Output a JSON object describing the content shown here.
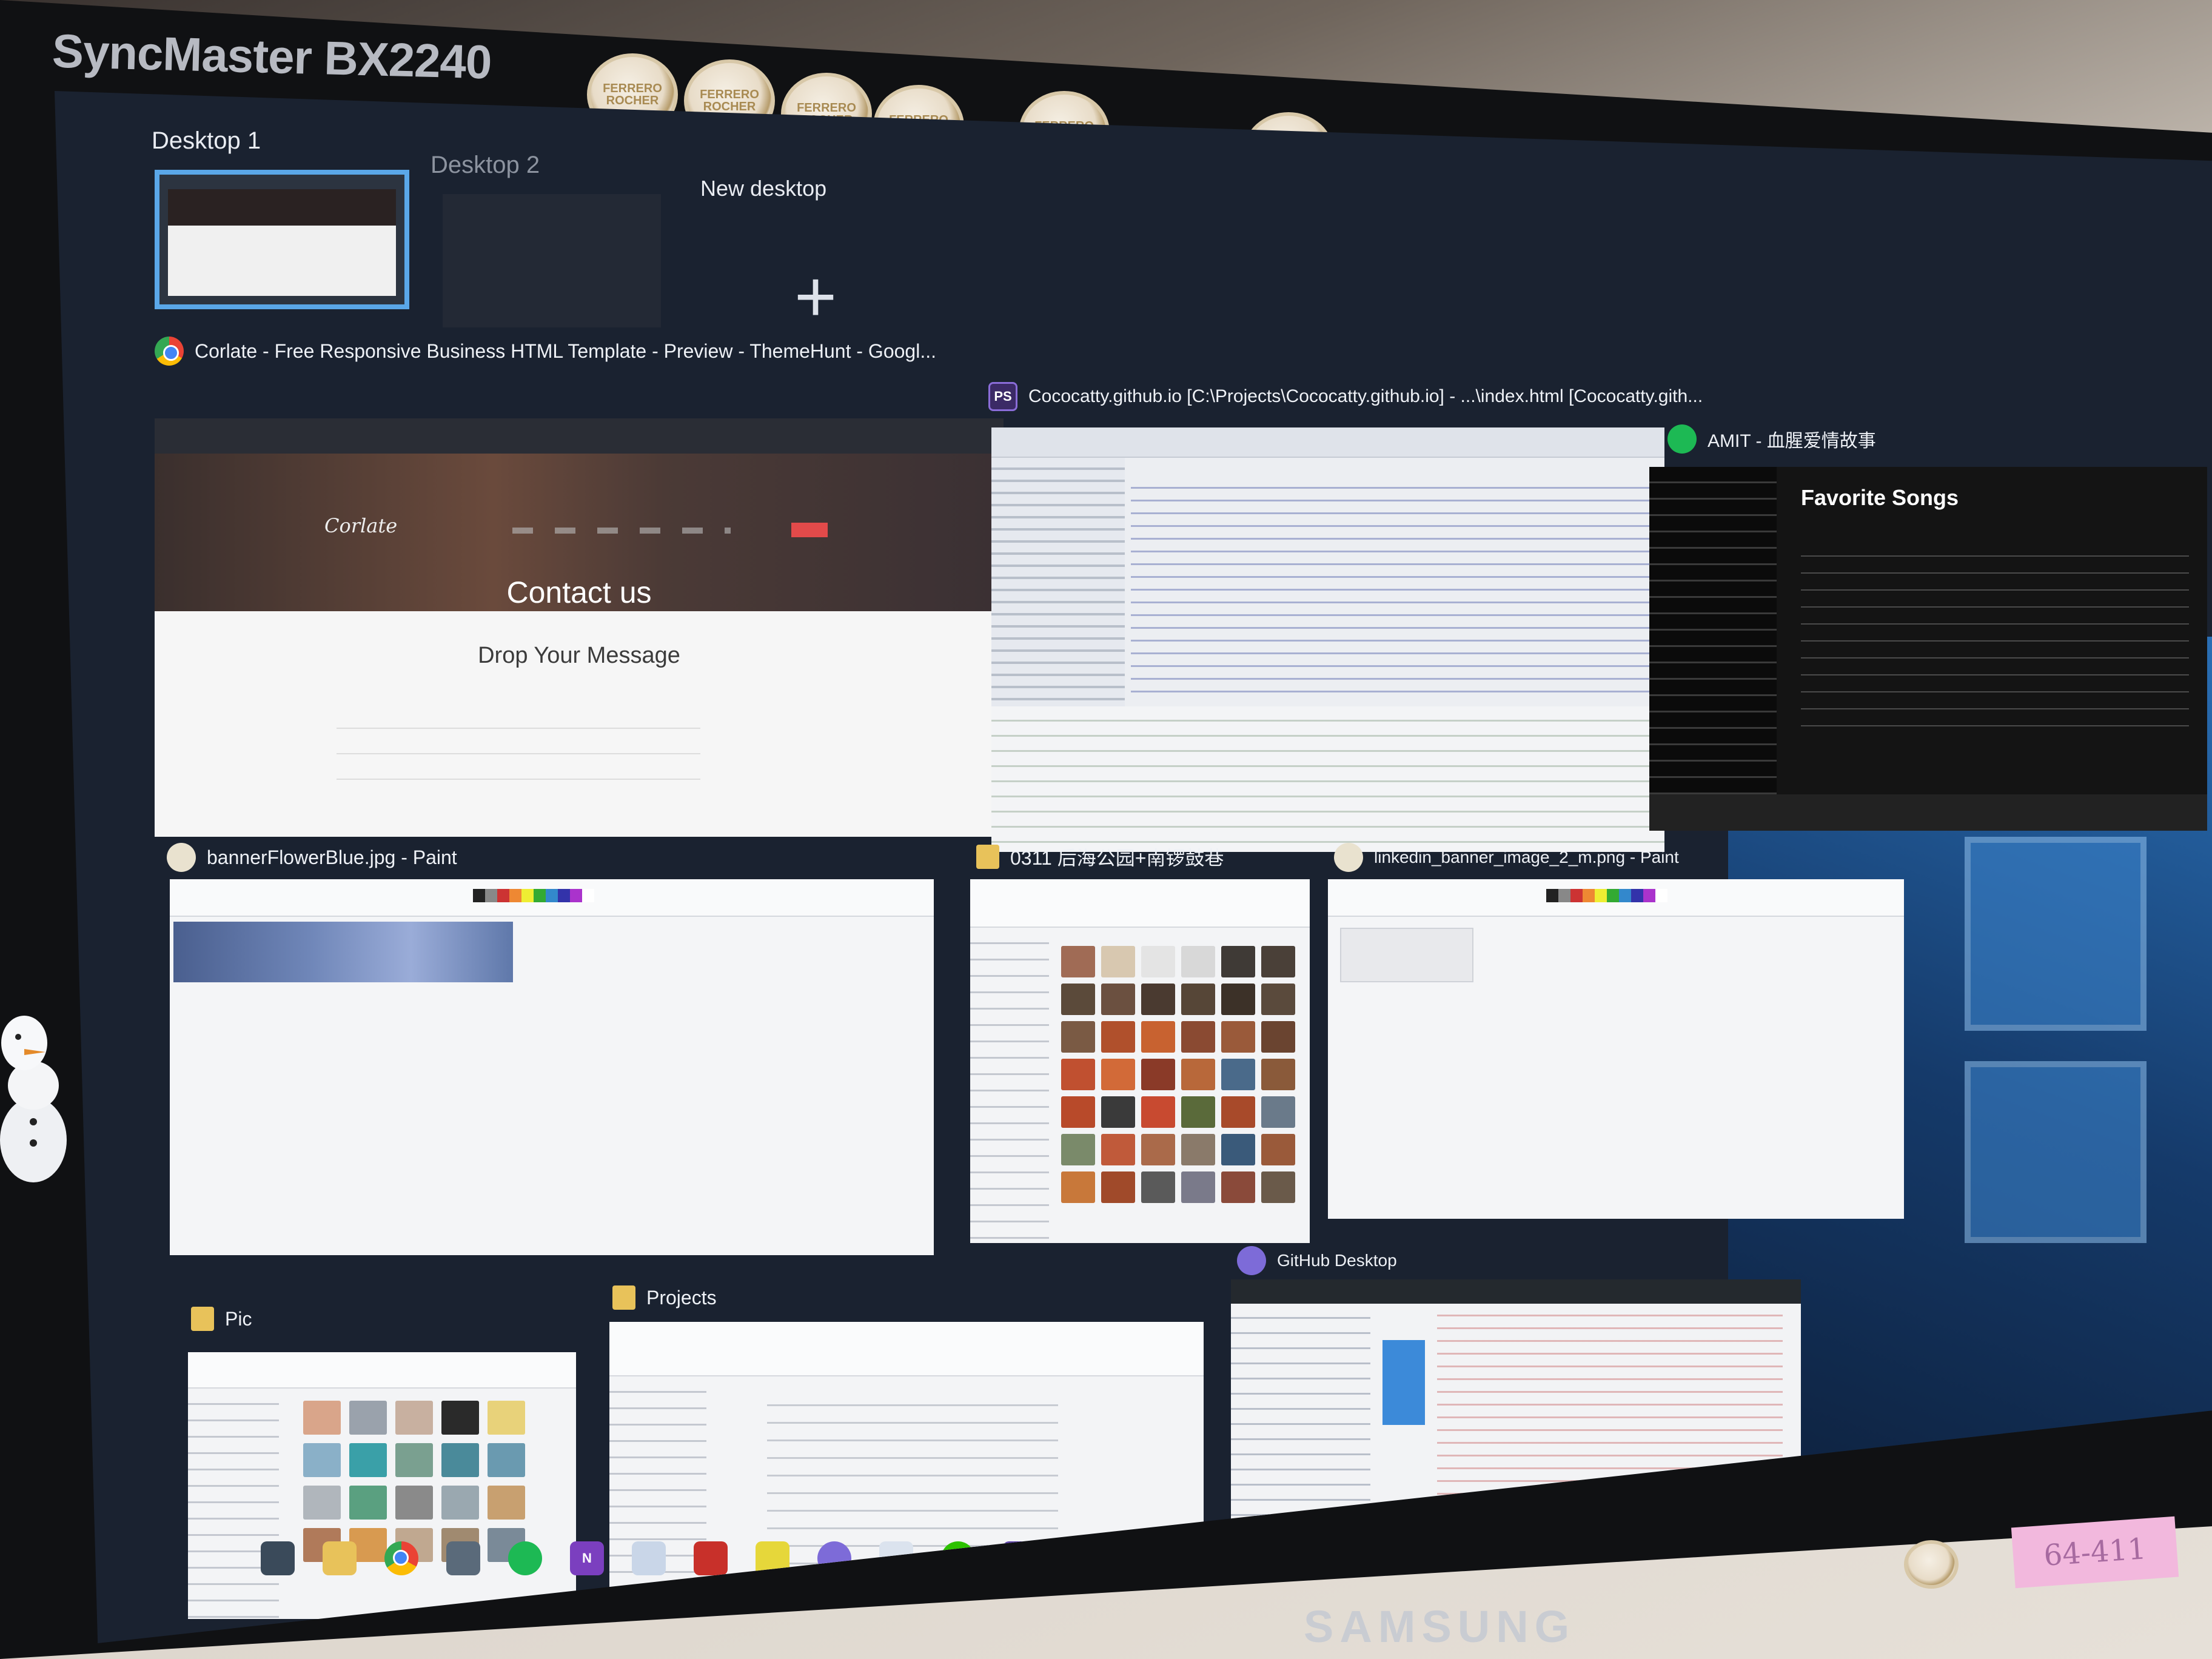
{
  "monitor": {
    "model": "SyncMaster BX2240",
    "brand": "SAMSUNG"
  },
  "stickers": {
    "text": "FERRERO ROCHER",
    "postit_text": "64-411"
  },
  "task_view": {
    "desktops": [
      {
        "label": "Desktop 1",
        "active": true
      },
      {
        "label": "Desktop 2",
        "active": false
      }
    ],
    "new_desktop": {
      "label": "New desktop",
      "glyph": "+"
    }
  },
  "windows": [
    {
      "id": "chrome",
      "title": "Corlate - Free Responsive Business HTML Template - Preview - ThemeHunt - Googl...",
      "icon": "chrome-icon",
      "content": {
        "logo": "Corlate",
        "hero_title": "Contact us",
        "section_title": "Drop Your Message"
      }
    },
    {
      "id": "phpstorm",
      "title": "Cococatty.github.io [C:\\Projects\\Cococatty.github.io] - ...\\index.html [Cococatty.gith...",
      "icon": "ps-icon",
      "icon_text": "PS"
    },
    {
      "id": "spotify",
      "title": "AMIT - 血腥爱情故事",
      "icon": "spotify-icon",
      "content": {
        "playlist_title": "Favorite Songs"
      }
    },
    {
      "id": "paint1",
      "title": "bannerFlowerBlue.jpg - Paint",
      "icon": "paint-icon"
    },
    {
      "id": "explorer-photos",
      "title": "0311 后海公园+南锣鼓巷",
      "icon": "folder-icon"
    },
    {
      "id": "paint2",
      "title": "linkedin_banner_image_2_m.png - Paint",
      "icon": "paint-icon"
    },
    {
      "id": "explorer-pic",
      "title": "Pic",
      "icon": "folder-icon"
    },
    {
      "id": "explorer-projects",
      "title": "Projects",
      "icon": "folder-icon"
    },
    {
      "id": "github",
      "title": "GitHub Desktop",
      "icon": "github-icon"
    }
  ],
  "taskbar": {
    "icons": [
      "task-view-icon",
      "file-explorer-icon",
      "chrome-icon",
      "mail-icon",
      "spotify-icon",
      "onenote-icon",
      "paint-icon",
      "teams-icon",
      "sticky-notes-icon",
      "github-icon",
      "onedrive-icon",
      "wechat-icon",
      "phpstorm-icon",
      "paint-alt-icon"
    ],
    "colors": {
      "chrome": "#4285f4",
      "spotify": "#1db954",
      "onenote": "#7b3fbf",
      "wechat": "#2dc100",
      "phpstorm": "#5b3fa6",
      "github": "#7d6bd8",
      "sticky": "#e6d73a"
    }
  },
  "accent": "#5aa7e8"
}
